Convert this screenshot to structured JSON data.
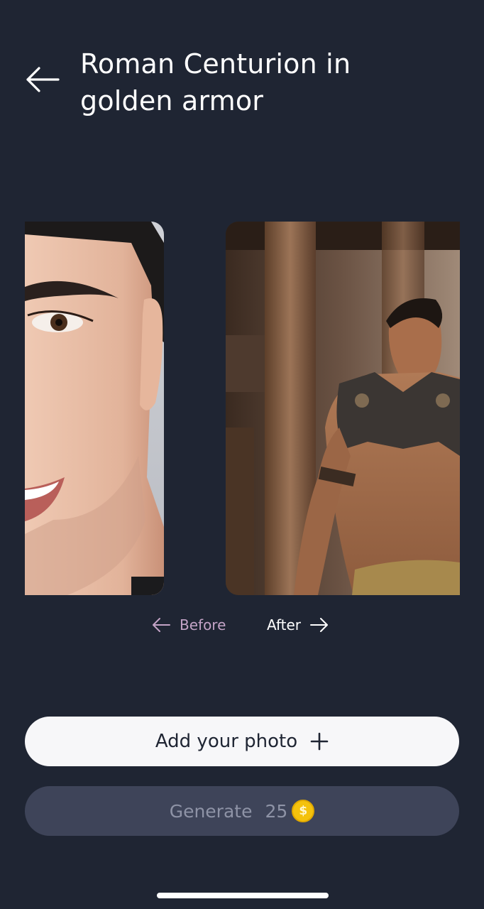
{
  "header": {
    "title": "Roman Centurion in golden armor",
    "back_icon": "arrow-left-icon"
  },
  "preview": {
    "before_image": "face-portrait-image",
    "after_image": "gladiator-image",
    "before_label": "Before",
    "after_label": "After"
  },
  "actions": {
    "add_photo_label": "Add your photo",
    "add_icon": "plus-icon",
    "generate_label": "Generate",
    "generate_cost": "25",
    "coin_symbol": "$",
    "coin_icon": "coin-icon"
  },
  "colors": {
    "background": "#1f2533",
    "primary_button": "#f7f7f9",
    "disabled_button": "#3e4459",
    "before_label": "#c3a3c6",
    "coin": "#f4c20d"
  }
}
